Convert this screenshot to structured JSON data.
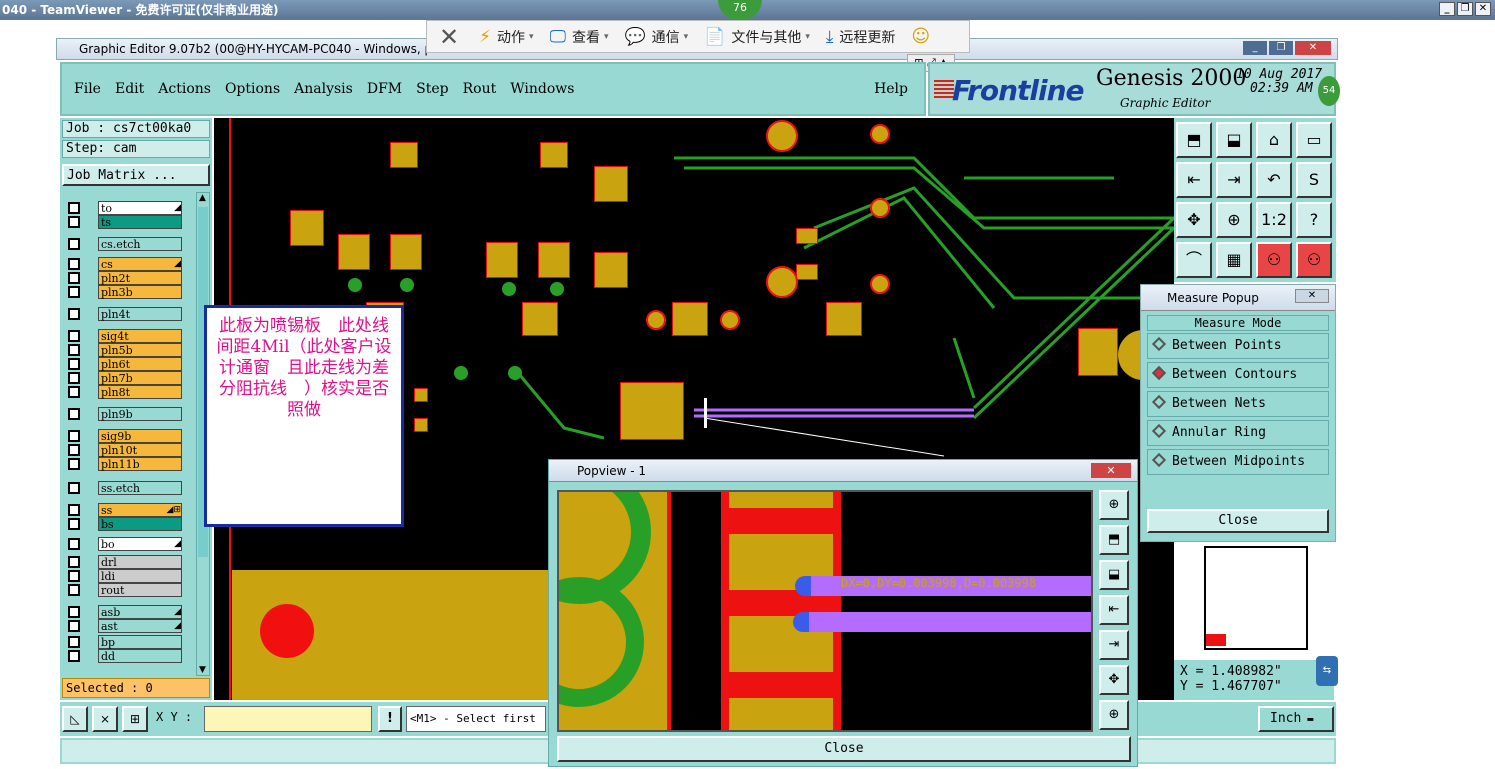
{
  "teamviewer": {
    "window_title": "040 - TeamViewer - 免费许可证(仅非商业用途)",
    "badge": "76",
    "toolbar": [
      {
        "label": "动作",
        "icon": "lightning-icon"
      },
      {
        "label": "查看",
        "icon": "monitor-icon"
      },
      {
        "label": "通信",
        "icon": "chat-icon"
      },
      {
        "label": "文件与其他",
        "icon": "file-icon"
      },
      {
        "label": "远程更新",
        "icon": "download-icon"
      }
    ],
    "side_badge": "54"
  },
  "app": {
    "title": "Graphic Editor 9.07b2 (00@HY-HYCAM-PC040 - Windows, p",
    "menu": [
      "File",
      "Edit",
      "Actions",
      "Options",
      "Analysis",
      "DFM",
      "Step",
      "Rout",
      "Windows"
    ],
    "help": "Help",
    "brand": {
      "logo": "Frontline",
      "product": "Genesis 2000",
      "subtitle": "Graphic Editor",
      "date": "10 Aug 2017",
      "time": "02:39 AM"
    }
  },
  "left_panel": {
    "job": "Job : cs7ct00ka0",
    "step": "Step: cam",
    "job_matrix": "Job Matrix ...",
    "layers": [
      {
        "name": "to",
        "color": "#ffffff",
        "mark": "◢"
      },
      {
        "name": "ts",
        "color": "#0d9a82",
        "mark": ""
      },
      {
        "name": "cs.etch",
        "color": "#99d9d4",
        "mark": ""
      },
      {
        "name": "cs",
        "color": "#f5b83c",
        "mark": "◢"
      },
      {
        "name": "pln2t",
        "color": "#f5b83c",
        "mark": ""
      },
      {
        "name": "pln3b",
        "color": "#f5b83c",
        "mark": ""
      },
      {
        "name": "pln4t",
        "color": "#99d9d4",
        "mark": ""
      },
      {
        "name": "sig4t",
        "color": "#f5b83c",
        "mark": ""
      },
      {
        "name": "pln5b",
        "color": "#f5b83c",
        "mark": ""
      },
      {
        "name": "pln6t",
        "color": "#f5b83c",
        "mark": ""
      },
      {
        "name": "pln7b",
        "color": "#f5b83c",
        "mark": ""
      },
      {
        "name": "pln8t",
        "color": "#f5b83c",
        "mark": ""
      },
      {
        "name": "pln9b",
        "color": "#99d9d4",
        "mark": ""
      },
      {
        "name": "sig9b",
        "color": "#f5b83c",
        "mark": ""
      },
      {
        "name": "pln10t",
        "color": "#f5b83c",
        "mark": ""
      },
      {
        "name": "pln11b",
        "color": "#f5b83c",
        "mark": ""
      },
      {
        "name": "ss.etch",
        "color": "#99d9d4",
        "mark": ""
      },
      {
        "name": "ss",
        "color": "#f5b83c",
        "mark": "◢⊞"
      },
      {
        "name": "bs",
        "color": "#0d9a82",
        "mark": ""
      },
      {
        "name": "bo",
        "color": "#ffffff",
        "mark": "◢"
      },
      {
        "name": "drl",
        "color": "#cccccc",
        "mark": ""
      },
      {
        "name": "ldi",
        "color": "#cccccc",
        "mark": ""
      },
      {
        "name": "rout",
        "color": "#cccccc",
        "mark": ""
      },
      {
        "name": "asb",
        "color": "#99d9d4",
        "mark": "◢"
      },
      {
        "name": "ast",
        "color": "#99d9d4",
        "mark": "◢"
      },
      {
        "name": "bp",
        "color": "#99d9d4",
        "mark": ""
      },
      {
        "name": "dd",
        "color": "#99d9d4",
        "mark": ""
      }
    ],
    "selected": "Selected : 0"
  },
  "note": "此板为喷锡板　此处线间距4Mil（此处客户设计通窗　且此走线为差分阻抗线　）核实是否照做",
  "measure_popup": {
    "title": "Measure Popup",
    "mode_header": "Measure Mode",
    "options": [
      {
        "label": "Between Points",
        "selected": false
      },
      {
        "label": "Between Contours",
        "selected": true
      },
      {
        "label": "Between Nets",
        "selected": false
      },
      {
        "label": "Annular Ring",
        "selected": false
      },
      {
        "label": "Between Midpoints",
        "selected": false
      }
    ],
    "close": "Close"
  },
  "coords": {
    "x": "X = 1.408982\"",
    "y": "Y = 1.467707\""
  },
  "bottom": {
    "xy_label": "X Y :",
    "xy_value": "",
    "bang": "!",
    "prompt": "<M1> - Select first",
    "units": "Inch"
  },
  "popview": {
    "title": "Popview - 1",
    "measurement": "DX=0,DY=0.003998,D=0.003998",
    "close": "Close"
  }
}
